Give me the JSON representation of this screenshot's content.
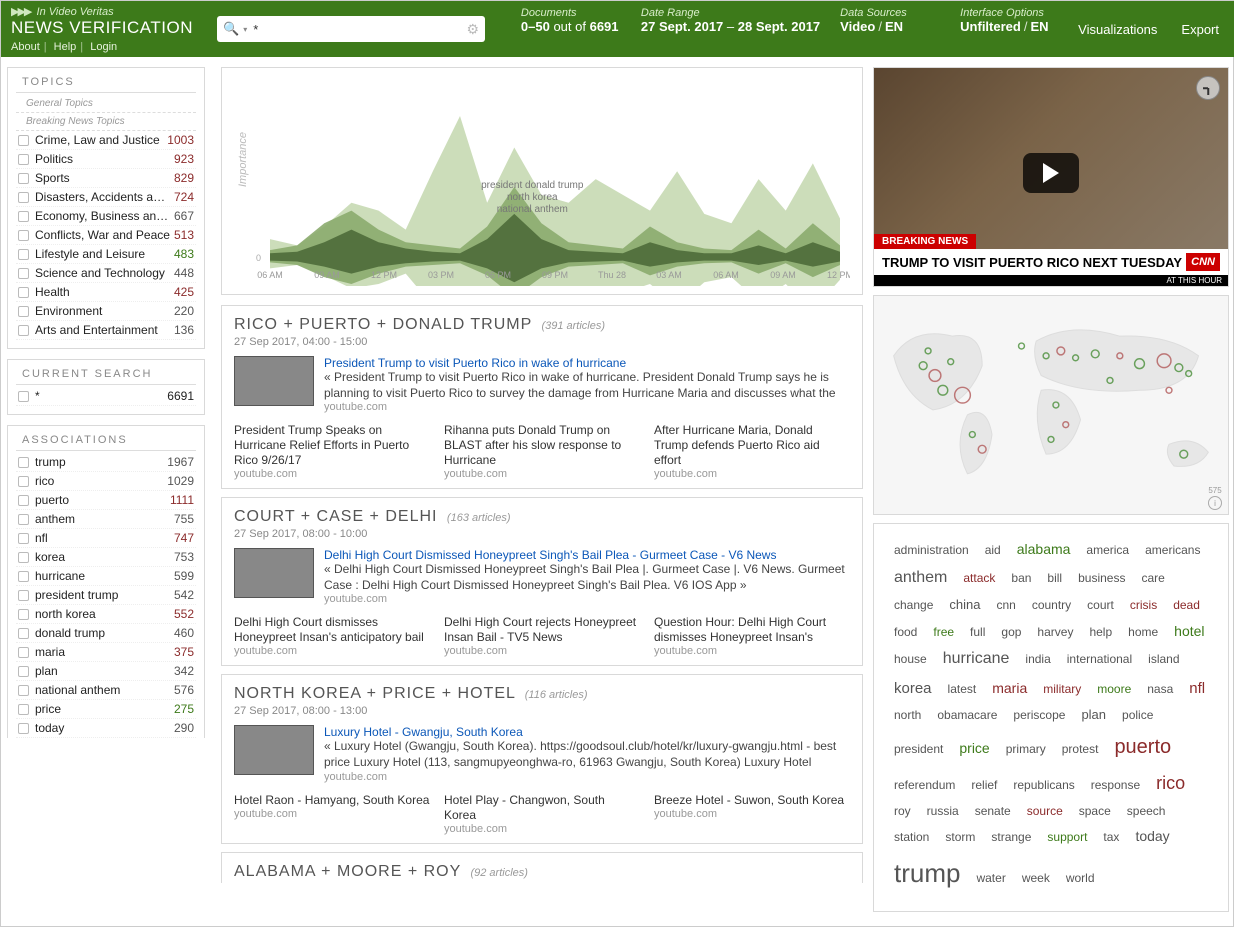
{
  "brand": {
    "tag_pre": "▶▶▶",
    "tag": "In Video Veritas",
    "title": "NEWS VERIFICATION",
    "about": "About",
    "help": "Help",
    "login": "Login"
  },
  "search": {
    "query": "*"
  },
  "meta": {
    "docs_label": "Documents",
    "docs_val_a": "0–50",
    "docs_val_mid": "out of",
    "docs_val_b": "6691",
    "range_label": "Date Range",
    "range_a": "27 Sept. 2017",
    "range_b": "28 Sept. 2017",
    "src_label": "Data Sources",
    "src_a": "Video",
    "src_b": "EN",
    "opt_label": "Interface Options",
    "opt_a": "Unfiltered",
    "opt_b": "EN",
    "viz": "Visualizations",
    "export": "Export"
  },
  "topics": {
    "header": "TOPICS",
    "sub1": "General Topics",
    "sub2": "Breaking News Topics",
    "items": [
      {
        "label": "Crime, Law and Justice",
        "count": "1003",
        "color": "#8b2b2b"
      },
      {
        "label": "Politics",
        "count": "923",
        "color": "#8b2b2b"
      },
      {
        "label": "Sports",
        "count": "829",
        "color": "#8b2b2b"
      },
      {
        "label": "Disasters, Accidents and Eme…",
        "count": "724",
        "color": "#8b2b2b"
      },
      {
        "label": "Economy, Business and Finan…",
        "count": "667",
        "color": "#555"
      },
      {
        "label": "Conflicts, War and Peace",
        "count": "513",
        "color": "#8b2b2b"
      },
      {
        "label": "Lifestyle and Leisure",
        "count": "483",
        "color": "#3d7a1a"
      },
      {
        "label": "Science and Technology",
        "count": "448",
        "color": "#555"
      },
      {
        "label": "Health",
        "count": "425",
        "color": "#8b2b2b"
      },
      {
        "label": "Environment",
        "count": "220",
        "color": "#555"
      },
      {
        "label": "Arts and Entertainment",
        "count": "136",
        "color": "#555"
      }
    ]
  },
  "cursearch": {
    "header": "CURRENT SEARCH",
    "q": "*",
    "total": "6691"
  },
  "assoc": {
    "header": "ASSOCIATIONS",
    "items": [
      {
        "label": "trump",
        "count": "1967",
        "color": "#555"
      },
      {
        "label": "rico",
        "count": "1029",
        "color": "#555"
      },
      {
        "label": "puerto",
        "count": "1111",
        "color": "#8b2b2b"
      },
      {
        "label": "anthem",
        "count": "755",
        "color": "#555"
      },
      {
        "label": "nfl",
        "count": "747",
        "color": "#8b2b2b"
      },
      {
        "label": "korea",
        "count": "753",
        "color": "#555"
      },
      {
        "label": "hurricane",
        "count": "599",
        "color": "#555"
      },
      {
        "label": "president trump",
        "count": "542",
        "color": "#555"
      },
      {
        "label": "north korea",
        "count": "552",
        "color": "#8b2b2b"
      },
      {
        "label": "donald trump",
        "count": "460",
        "color": "#555"
      },
      {
        "label": "maria",
        "count": "375",
        "color": "#8b2b2b"
      },
      {
        "label": "plan",
        "count": "342",
        "color": "#555"
      },
      {
        "label": "national anthem",
        "count": "576",
        "color": "#555"
      },
      {
        "label": "price",
        "count": "275",
        "color": "#3d7a1a"
      },
      {
        "label": "today",
        "count": "290",
        "color": "#555"
      }
    ]
  },
  "chart_data": {
    "type": "area",
    "title": "",
    "ylabel": "Importance",
    "x_ticks": [
      "06 AM",
      "09 AM",
      "12 PM",
      "03 PM",
      "06 PM",
      "09 PM",
      "Thu 28",
      "03 AM",
      "06 AM",
      "09 AM",
      "12 PM"
    ],
    "annotations": [
      "president donald trump",
      "north korea",
      "national anthem"
    ],
    "series_count": 3,
    "x": [
      0,
      1,
      2,
      3,
      4,
      5,
      6,
      7,
      8,
      9,
      10,
      11,
      12,
      13,
      14,
      15,
      16,
      17,
      18,
      19,
      20,
      21
    ],
    "series": [
      {
        "name": "upper",
        "color": "#c7d9b3",
        "values": [
          12,
          8,
          20,
          35,
          30,
          18,
          55,
          90,
          35,
          70,
          40,
          35,
          50,
          40,
          30,
          55,
          28,
          22,
          50,
          30,
          60,
          25
        ]
      },
      {
        "name": "mid",
        "color": "#8bab6e",
        "values": [
          5,
          8,
          22,
          30,
          18,
          10,
          8,
          6,
          20,
          45,
          22,
          10,
          8,
          6,
          20,
          10,
          6,
          5,
          18,
          6,
          22,
          8
        ]
      },
      {
        "name": "dark",
        "color": "#4e6b3a",
        "values": [
          3,
          4,
          10,
          18,
          10,
          6,
          4,
          3,
          12,
          28,
          12,
          5,
          4,
          3,
          10,
          5,
          3,
          3,
          8,
          3,
          10,
          4
        ]
      }
    ]
  },
  "stories": [
    {
      "title": "RICO + PUERTO + DONALD TRUMP",
      "artcount": "(391 articles)",
      "date": "27 Sep 2017, 04:00 - 15:00",
      "lead_title": "President Trump to visit Puerto Rico in wake of hurricane",
      "lead_snip": "« President Trump to visit Puerto Rico in wake of hurricane. President Donald Trump says he is planning to visit Puerto Rico to survey the damage from Hurricane Maria and discusses what the",
      "lead_src": "youtube.com",
      "subs": [
        {
          "t": "President Trump Speaks on Hurricane Relief Efforts in Puerto Rico 9/26/17",
          "s": "youtube.com"
        },
        {
          "t": "Rihanna puts Donald Trump on BLAST after his slow response to Hurricane",
          "s": "youtube.com"
        },
        {
          "t": "After Hurricane Maria, Donald Trump defends Puerto Rico aid effort",
          "s": "youtube.com"
        }
      ]
    },
    {
      "title": "COURT + CASE + DELHI",
      "artcount": "(163 articles)",
      "date": "27 Sep 2017, 08:00 - 10:00",
      "lead_title": "Delhi High Court Dismissed Honeypreet Singh's Bail Plea - Gurmeet Case - V6 News",
      "lead_snip": "« Delhi High Court Dismissed Honeypreet Singh's Bail Plea |. Gurmeet Case |. V6 News. Gurmeet Case : Delhi High Court Dismissed Honeypreet Singh's Bail Plea. V6 IOS App »",
      "lead_src": "youtube.com",
      "subs": [
        {
          "t": "Delhi High Court dismisses Honeypreet Insan's anticipatory bail",
          "s": "youtube.com"
        },
        {
          "t": "Delhi High Court rejects Honeypreet Insan Bail - TV5 News",
          "s": "youtube.com"
        },
        {
          "t": "Question Hour: Delhi High Court dismisses Honeypreet Insan's",
          "s": "youtube.com"
        }
      ]
    },
    {
      "title": "NORTH KOREA + PRICE + HOTEL",
      "artcount": "(116 articles)",
      "date": "27 Sep 2017, 08:00 - 13:00",
      "lead_title": "Luxury Hotel - Gwangju, South Korea",
      "lead_snip": "« Luxury Hotel (Gwangju, South Korea). https://goodsoul.club/hotel/kr/luxury-gwangju.html - best price Luxury Hotel (113, sangmupyeonghwa-ro, 61963 Gwangju, South Korea) Luxury Hotel",
      "lead_src": "youtube.com",
      "subs": [
        {
          "t": "Hotel Raon - Hamyang, South Korea",
          "s": "youtube.com"
        },
        {
          "t": "Hotel Play - Changwon, South Korea",
          "s": "youtube.com"
        },
        {
          "t": "Breeze Hotel - Suwon, South Korea",
          "s": "youtube.com"
        }
      ]
    },
    {
      "title": "ALABAMA + MOORE + ROY",
      "artcount": "(92 articles)",
      "date": "",
      "lead_title": "",
      "lead_snip": "",
      "lead_src": "",
      "subs": []
    }
  ],
  "video": {
    "breaking": "BREAKING NEWS",
    "chyron": "TRUMP TO VISIT PUERTO RICO NEXT TUESDAY",
    "logo": "CNN",
    "at_hour": "AT THIS HOUR"
  },
  "map": {
    "zoomcount": "575",
    "info": "i"
  },
  "cloud": [
    {
      "w": "administration",
      "s": 12,
      "c": "#555"
    },
    {
      "w": "aid",
      "s": 12,
      "c": "#555"
    },
    {
      "w": "alabama",
      "s": 14,
      "c": "#3d7a1a"
    },
    {
      "w": "america",
      "s": 12,
      "c": "#555"
    },
    {
      "w": "americans",
      "s": 12,
      "c": "#555"
    },
    {
      "w": "anthem",
      "s": 16,
      "c": "#555"
    },
    {
      "w": "attack",
      "s": 12,
      "c": "#8b2b2b"
    },
    {
      "w": "ban",
      "s": 12,
      "c": "#555"
    },
    {
      "w": "bill",
      "s": 12,
      "c": "#555"
    },
    {
      "w": "business",
      "s": 12,
      "c": "#555"
    },
    {
      "w": "care",
      "s": 12,
      "c": "#555"
    },
    {
      "w": "change",
      "s": 12,
      "c": "#555"
    },
    {
      "w": "china",
      "s": 13,
      "c": "#555"
    },
    {
      "w": "cnn",
      "s": 12,
      "c": "#555"
    },
    {
      "w": "country",
      "s": 12,
      "c": "#555"
    },
    {
      "w": "court",
      "s": 12,
      "c": "#555"
    },
    {
      "w": "crisis",
      "s": 12,
      "c": "#8b2b2b"
    },
    {
      "w": "dead",
      "s": 12,
      "c": "#8b2b2b"
    },
    {
      "w": "food",
      "s": 12,
      "c": "#555"
    },
    {
      "w": "free",
      "s": 12,
      "c": "#3d7a1a"
    },
    {
      "w": "full",
      "s": 12,
      "c": "#555"
    },
    {
      "w": "gop",
      "s": 12,
      "c": "#555"
    },
    {
      "w": "harvey",
      "s": 12,
      "c": "#555"
    },
    {
      "w": "help",
      "s": 12,
      "c": "#555"
    },
    {
      "w": "home",
      "s": 12,
      "c": "#555"
    },
    {
      "w": "hotel",
      "s": 14,
      "c": "#3d7a1a"
    },
    {
      "w": "house",
      "s": 12,
      "c": "#555"
    },
    {
      "w": "hurricane",
      "s": 16,
      "c": "#555"
    },
    {
      "w": "india",
      "s": 12,
      "c": "#555"
    },
    {
      "w": "international",
      "s": 12,
      "c": "#555"
    },
    {
      "w": "island",
      "s": 12,
      "c": "#555"
    },
    {
      "w": "korea",
      "s": 15,
      "c": "#555"
    },
    {
      "w": "latest",
      "s": 12,
      "c": "#555"
    },
    {
      "w": "maria",
      "s": 14,
      "c": "#8b2b2b"
    },
    {
      "w": "military",
      "s": 12,
      "c": "#8b2b2b"
    },
    {
      "w": "moore",
      "s": 12,
      "c": "#3d7a1a"
    },
    {
      "w": "nasa",
      "s": 12,
      "c": "#555"
    },
    {
      "w": "nfl",
      "s": 15,
      "c": "#8b2b2b"
    },
    {
      "w": "north",
      "s": 12,
      "c": "#555"
    },
    {
      "w": "obamacare",
      "s": 12,
      "c": "#555"
    },
    {
      "w": "periscope",
      "s": 12,
      "c": "#555"
    },
    {
      "w": "plan",
      "s": 13,
      "c": "#555"
    },
    {
      "w": "police",
      "s": 12,
      "c": "#555"
    },
    {
      "w": "president",
      "s": 12,
      "c": "#555"
    },
    {
      "w": "price",
      "s": 14,
      "c": "#3d7a1a"
    },
    {
      "w": "primary",
      "s": 12,
      "c": "#555"
    },
    {
      "w": "protest",
      "s": 12,
      "c": "#555"
    },
    {
      "w": "puerto",
      "s": 20,
      "c": "#8b2b2b"
    },
    {
      "w": "referendum",
      "s": 12,
      "c": "#555"
    },
    {
      "w": "relief",
      "s": 12,
      "c": "#555"
    },
    {
      "w": "republicans",
      "s": 12,
      "c": "#555"
    },
    {
      "w": "response",
      "s": 12,
      "c": "#555"
    },
    {
      "w": "rico",
      "s": 18,
      "c": "#8b2b2b"
    },
    {
      "w": "roy",
      "s": 12,
      "c": "#555"
    },
    {
      "w": "russia",
      "s": 12,
      "c": "#555"
    },
    {
      "w": "senate",
      "s": 12,
      "c": "#555"
    },
    {
      "w": "source",
      "s": 12,
      "c": "#8b2b2b"
    },
    {
      "w": "space",
      "s": 12,
      "c": "#555"
    },
    {
      "w": "speech",
      "s": 12,
      "c": "#555"
    },
    {
      "w": "station",
      "s": 12,
      "c": "#555"
    },
    {
      "w": "storm",
      "s": 12,
      "c": "#555"
    },
    {
      "w": "strange",
      "s": 12,
      "c": "#555"
    },
    {
      "w": "support",
      "s": 12,
      "c": "#3d7a1a"
    },
    {
      "w": "tax",
      "s": 12,
      "c": "#555"
    },
    {
      "w": "today",
      "s": 14,
      "c": "#555"
    },
    {
      "w": "trump",
      "s": 26,
      "c": "#555"
    },
    {
      "w": "water",
      "s": 12,
      "c": "#555"
    },
    {
      "w": "week",
      "s": 12,
      "c": "#555"
    },
    {
      "w": "world",
      "s": 12,
      "c": "#555"
    }
  ]
}
